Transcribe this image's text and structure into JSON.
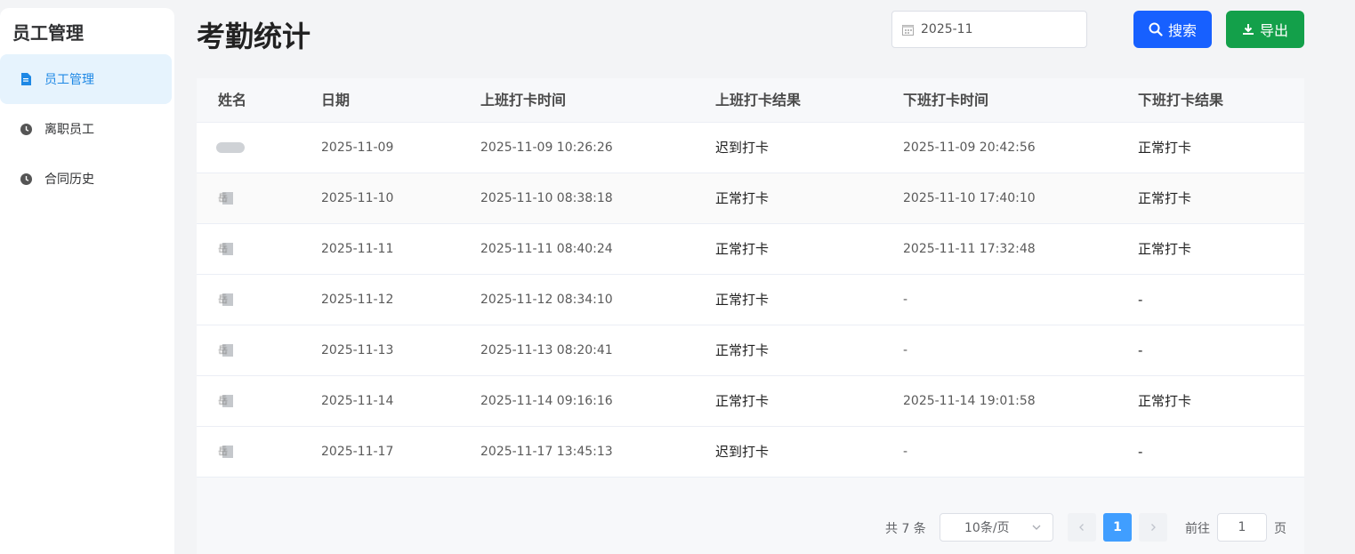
{
  "sidebar": {
    "title": "员工管理",
    "items": [
      {
        "label": "员工管理",
        "active": true,
        "icon": "document-icon"
      },
      {
        "label": "离职员工",
        "active": false,
        "icon": "clock-icon"
      },
      {
        "label": "合同历史",
        "active": false,
        "icon": "clock-icon"
      }
    ]
  },
  "header": {
    "title": "考勤统计",
    "month_value": "2025-11",
    "search_label": "搜索",
    "export_label": "导出"
  },
  "table": {
    "columns": [
      "姓名",
      "日期",
      "上班打卡时间",
      "上班打卡结果",
      "下班打卡时间",
      "下班打卡结果"
    ],
    "rows": [
      {
        "name": "",
        "date": "2025-11-09",
        "in_time": "2025-11-09 10:26:26",
        "in_result": "迟到打卡",
        "out_time": "2025-11-09 20:42:56",
        "out_result": "正常打卡"
      },
      {
        "name": "岳",
        "date": "2025-11-10",
        "in_time": "2025-11-10 08:38:18",
        "in_result": "正常打卡",
        "out_time": "2025-11-10 17:40:10",
        "out_result": "正常打卡"
      },
      {
        "name": "岳",
        "date": "2025-11-11",
        "in_time": "2025-11-11 08:40:24",
        "in_result": "正常打卡",
        "out_time": "2025-11-11 17:32:48",
        "out_result": "正常打卡"
      },
      {
        "name": "岳",
        "date": "2025-11-12",
        "in_time": "2025-11-12 08:34:10",
        "in_result": "正常打卡",
        "out_time": "-",
        "out_result": "-"
      },
      {
        "name": "岳",
        "date": "2025-11-13",
        "in_time": "2025-11-13 08:20:41",
        "in_result": "正常打卡",
        "out_time": "-",
        "out_result": "-"
      },
      {
        "name": "岳",
        "date": "2025-11-14",
        "in_time": "2025-11-14 09:16:16",
        "in_result": "正常打卡",
        "out_time": "2025-11-14 19:01:58",
        "out_result": "正常打卡"
      },
      {
        "name": "岳",
        "date": "2025-11-17",
        "in_time": "2025-11-17 13:45:13",
        "in_result": "迟到打卡",
        "out_time": "-",
        "out_result": "-"
      }
    ]
  },
  "pagination": {
    "total_text": "共 7 条",
    "page_size": "10条/页",
    "current_page": "1",
    "goto_label": "前往",
    "goto_value": "1",
    "page_suffix": "页"
  },
  "colors": {
    "search_button": "#1760ff",
    "export_button": "#13a04a",
    "active_nav_bg": "#e6f3fd",
    "active_nav_text": "#1e88e5",
    "current_page": "#409eff"
  }
}
